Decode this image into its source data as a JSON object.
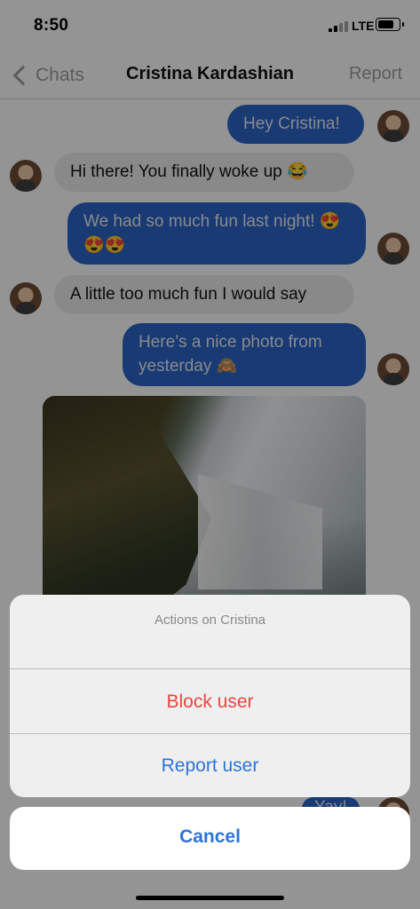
{
  "status_bar": {
    "time": "8:50",
    "network": "LTE"
  },
  "nav": {
    "back_label": "Chats",
    "title": "Cristina Kardashian",
    "right_action": "Report"
  },
  "messages": [
    {
      "direction": "outgoing",
      "text": "Hey Cristina!"
    },
    {
      "direction": "incoming",
      "text": "Hi there! You finally woke up 😂"
    },
    {
      "direction": "outgoing",
      "text": "We had so much fun last night! 😍😍😍"
    },
    {
      "direction": "incoming",
      "text": "A little too much fun I would say"
    },
    {
      "direction": "outgoing",
      "text": "Here’s a nice photo from yesterday 🙈"
    },
    {
      "direction": "outgoing",
      "text": "Yay!"
    }
  ],
  "action_sheet": {
    "title": "Actions on Cristina",
    "actions": [
      "Block user",
      "Report user"
    ],
    "cancel": "Cancel"
  },
  "colors": {
    "outgoing_bubble": "#2b62bf",
    "incoming_bubble": "#e4e4e4",
    "destructive": "#e9463f",
    "accent": "#2f73d9"
  }
}
